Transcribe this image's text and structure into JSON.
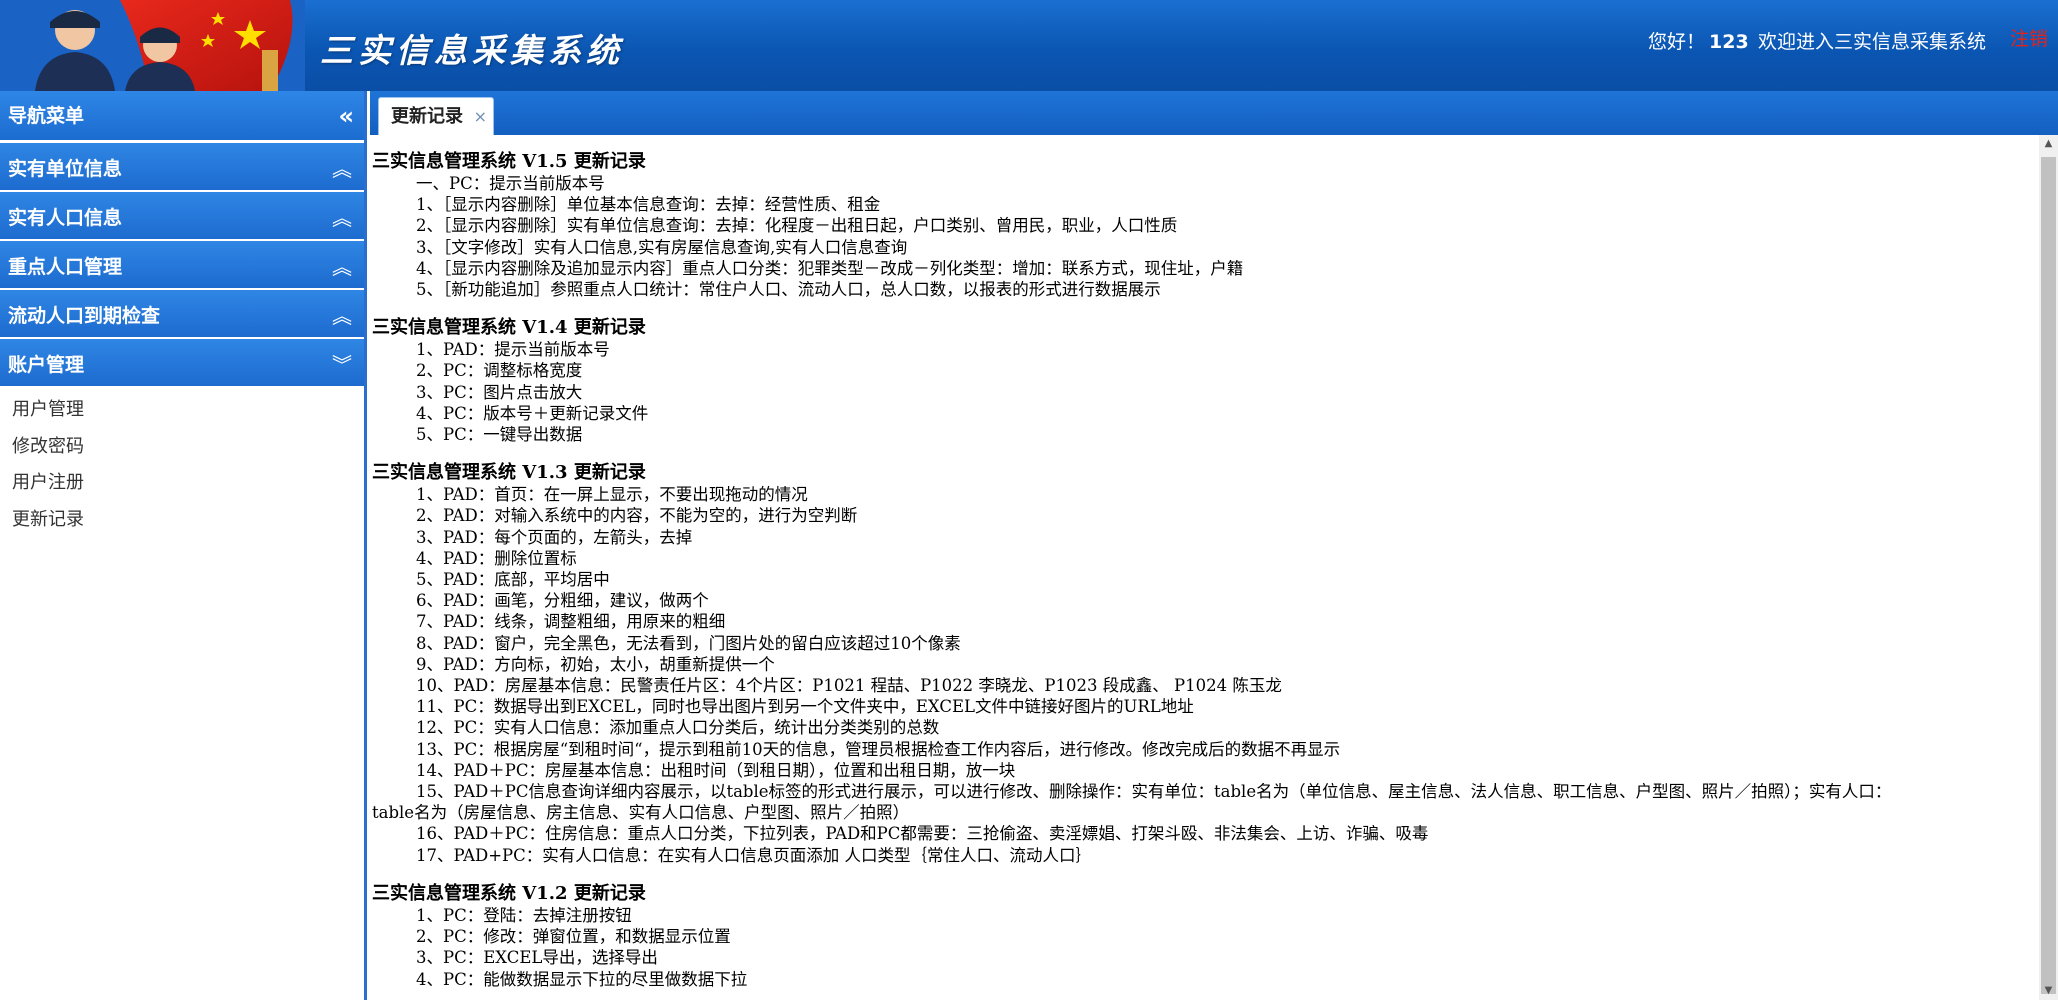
{
  "header": {
    "title": "三实信息采集系统",
    "greeting": "您好！",
    "username": "123",
    "welcome": "欢迎进入三实信息采集系统",
    "logout": "注销"
  },
  "sidebar": {
    "title": "导航菜单",
    "sections": [
      {
        "label": "实有单位信息"
      },
      {
        "label": "实有人口信息"
      },
      {
        "label": "重点人口管理"
      },
      {
        "label": "流动人口到期检查"
      },
      {
        "label": "账户管理"
      }
    ],
    "submenu": [
      "用户管理",
      "修改密码",
      "用户注册",
      "更新记录"
    ]
  },
  "tabs": [
    {
      "label": "更新记录"
    }
  ],
  "content": {
    "blocks": [
      {
        "title": "三实信息管理系统 V1.5 更新记录",
        "lines": [
          "一、PC：提示当前版本号",
          "1、［显示内容删除］单位基本信息查询：去掉：经营性质、租金",
          "2、［显示内容删除］实有单位信息查询：去掉：化程度－出租日起，户口类别、曾用民，职业，人口性质",
          "3、［文字修改］实有人口信息,实有房屋信息查询,实有人口信息查询",
          "4、［显示内容删除及追加显示内容］重点人口分类：犯罪类型－改成－列化类型：增加：联系方式，现住址，户籍",
          "5、［新功能追加］参照重点人口统计：常住户人口、流动人口，总人口数，以报表的形式进行数据展示"
        ]
      },
      {
        "title": "三实信息管理系统 V1.4 更新记录",
        "lines": [
          "1、PAD：提示当前版本号",
          "2、PC：调整标格宽度",
          "3、PC：图片点击放大",
          "4、PC：版本号＋更新记录文件",
          "5、PC：一键导出数据"
        ]
      },
      {
        "title": "三实信息管理系统 V1.3 更新记录",
        "lines": [
          "1、PAD：首页：在一屏上显示，不要出现拖动的情况",
          "2、PAD：对输入系统中的内容，不能为空的，进行为空判断",
          "3、PAD：每个页面的，左箭头，去掉",
          "4、PAD：删除位置标",
          "5、PAD：底部，平均居中",
          "6、PAD：画笔，分粗细，建议，做两个",
          "7、PAD：线条，调整粗细，用原来的粗细",
          "8、PAD：窗户，完全黑色，无法看到，门图片处的留白应该超过10个像素",
          "9、PAD：方向标，初始，太小，胡重新提供一个",
          "10、PAD：房屋基本信息：民警责任片区：4个片区：P1021 程喆、P1022 李晓龙、P1023 段成鑫、 P1024 陈玉龙",
          "11、PC：数据导出到EXCEL，同时也导出图片到另一个文件夹中，EXCEL文件中链接好图片的URL地址",
          "12、PC：实有人口信息：添加重点人口分类后，统计出分类类别的总数",
          "13、PC：根据房屋“到租时间“，提示到租前10天的信息，管理员根据检查工作内容后，进行修改。修改完成后的数据不再显示",
          "14、PAD＋PC：房屋基本信息：出租时间（到租日期），位置和出租日期，放一块",
          "15、PAD＋PC信息查询详细内容展示，以table标签的形式进行展示，可以进行修改、删除操作：实有单位：table名为（单位信息、屋主信息、法人信息、职工信息、户型图、照片／拍照）；实有人口：",
          "table名为（房屋信息、房主信息、实有人口信息、户型图、照片／拍照）",
          "16、PAD＋PC：住房信息：重点人口分类，下拉列表，PAD和PC都需要：三抢偷盗、卖淫嫖娼、打架斗殴、非法集会、上访、诈骗、吸毒",
          "17、PAD+PC：实有人口信息：在实有人口信息页面添加 人口类型｛常住人口、流动人口｝"
        ]
      },
      {
        "title": "三实信息管理系统 V1.2 更新记录",
        "lines": [
          "1、PC：登陆：去掉注册按钮",
          "2、PC：修改：弹窗位置，和数据显示位置",
          "3、PC：EXCEL导出，选择导出",
          "4、PC：能做数据显示下拉的尽里做数据下拉"
        ]
      }
    ]
  },
  "colors": {
    "header_blue": "#0b56b3",
    "nav_blue": "#1c6cd0",
    "logout_red": "#e2231a"
  },
  "icons": {
    "collapse": "double-chevron-left-icon",
    "section_open": "double-chevron-up-icon",
    "section_expanded": "double-chevron-down-icon",
    "tab_close": "close-icon"
  }
}
